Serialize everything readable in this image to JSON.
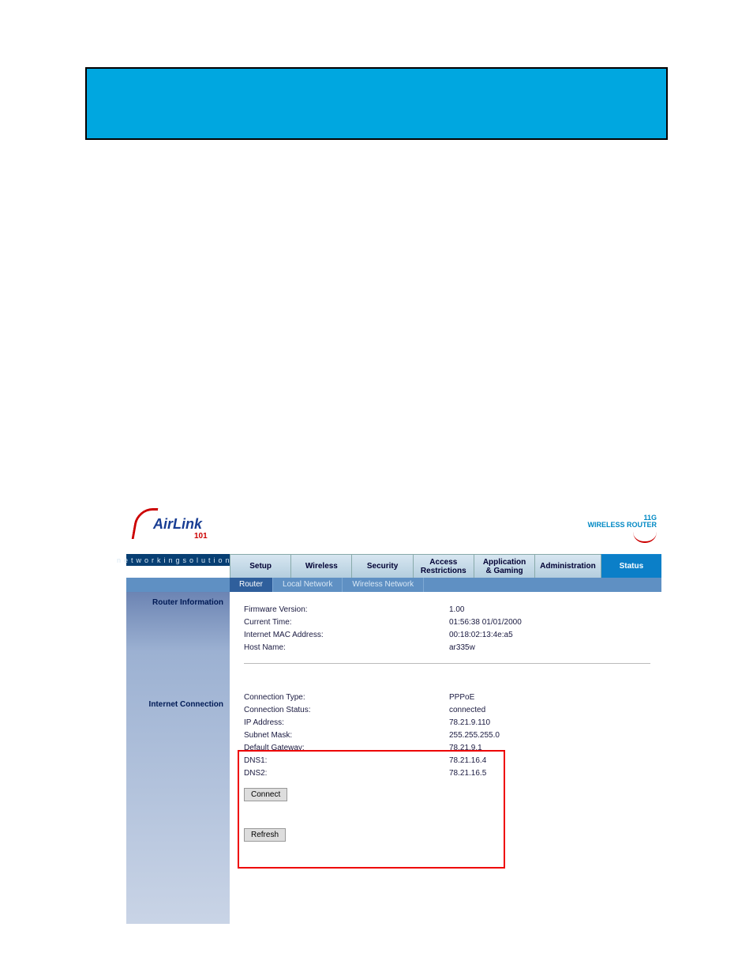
{
  "brand": {
    "name": "AirLink",
    "suffix": "101",
    "tagline": "networkingsolutions",
    "badge_line1": "11G",
    "badge_line2": "WIRELESS ROUTER"
  },
  "nav": {
    "tabs": [
      "Setup",
      "Wireless",
      "Security",
      "Access Restrictions",
      "Application & Gaming",
      "Administration",
      "Status"
    ],
    "active": "Status",
    "subtabs": [
      "Router",
      "Local Network",
      "Wireless Network"
    ],
    "active_sub": "Router"
  },
  "sections": {
    "router_info": "Router Information",
    "internet_conn": "Internet Connection"
  },
  "router_info": {
    "firmware_label": "Firmware Version:",
    "firmware_value": "1.00",
    "time_label": "Current Time:",
    "time_value": "01:56:38 01/01/2000",
    "mac_label": "Internet MAC Address:",
    "mac_value": "00:18:02:13:4e:a5",
    "host_label": "Host Name:",
    "host_value": "ar335w"
  },
  "internet": {
    "conn_type_label": "Connection Type:",
    "conn_type_value": "PPPoE",
    "conn_status_label": "Connection Status:",
    "conn_status_value": "connected",
    "ip_label": "IP Address:",
    "ip_value": "78.21.9.110",
    "mask_label": "Subnet Mask:",
    "mask_value": "255.255.255.0",
    "gw_label": "Default Gateway:",
    "gw_value": "78.21.9.1",
    "dns1_label": "DNS1:",
    "dns1_value": "78.21.16.4",
    "dns2_label": "DNS2:",
    "dns2_value": "78.21.16.5"
  },
  "buttons": {
    "connect": "Connect",
    "refresh": "Refresh"
  }
}
